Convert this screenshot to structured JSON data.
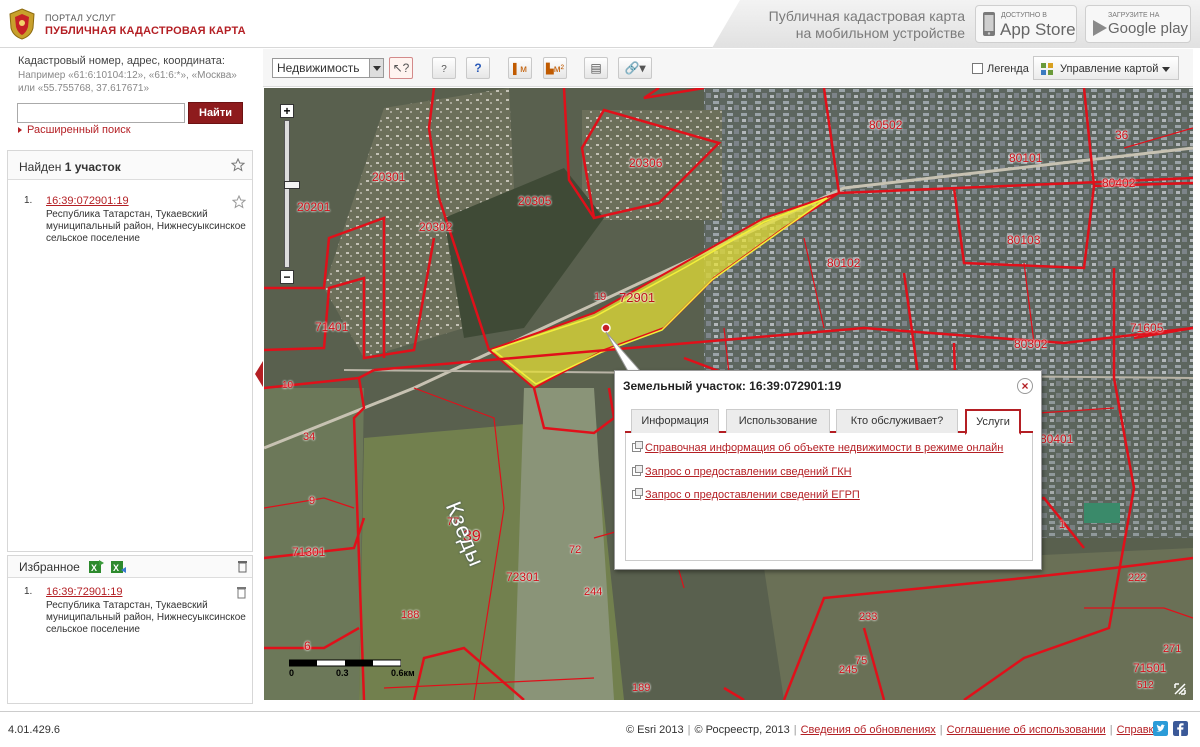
{
  "header": {
    "portal_small": "ПОРТАЛ УСЛУГ",
    "portal_title": "ПУБЛИЧНАЯ КАДАСТРОВАЯ КАРТА",
    "mobile_text": "Публичная кадастровая карта на мобильном устройстве",
    "appstore_small": "Доступно в",
    "appstore_big": "App Store",
    "googleplay_small": "Загрузите на",
    "googleplay_big": "Google play"
  },
  "search": {
    "label": "Кадастровый номер, адрес, координата:",
    "hint": "Например «61:6:10104:12», «61:6:*», «Москва» или «55.755768, 37.617671»",
    "value": "",
    "button": "Найти",
    "advanced": "Расширенный поиск"
  },
  "results": {
    "found_prefix": "Найден ",
    "found_count": "1 участок",
    "items": [
      {
        "num": "1.",
        "id": "16:39:072901:19",
        "address": "Республика Татарстан, Тукаевский муниципальный район, Нижнесуыксинское сельское поселение"
      }
    ]
  },
  "favorites": {
    "title": "Избранное",
    "items": [
      {
        "num": "1.",
        "id": "16:39:72901:19",
        "address": "Республика Татарстан, Тукаевский муниципальный район, Нижнесуыксинское сельское поселение"
      }
    ]
  },
  "toolbar": {
    "layer_select": "Недвижимость",
    "legend": "Легенда",
    "map_control": "Управление картой"
  },
  "map": {
    "labels": [
      "80502",
      "20306",
      "20301",
      "20201",
      "20305",
      "20302",
      "80101",
      "36",
      "80402",
      "80103",
      "80102",
      "71401",
      "71605",
      "80302",
      "10",
      "34",
      "80401",
      "9",
      "77",
      "39",
      "72",
      "71301",
      "72301",
      "244",
      "188",
      "222",
      "233",
      "75",
      "245",
      "6",
      "189",
      "271",
      "71501",
      "512",
      "1",
      "19",
      "72901"
    ],
    "river_label": "Кзеды",
    "scale_labels": [
      "0",
      "0.3",
      "0.6км"
    ]
  },
  "popup": {
    "title": "Земельный участок: 16:39:072901:19",
    "tabs": [
      "Информация",
      "Использование",
      "Кто обслуживает?",
      "Услуги"
    ],
    "active_tab": "Услуги",
    "services": [
      "Справочная информация об объекте недвижимости в режиме онлайн",
      "Запрос о предоставлении сведений ГКН",
      "Запрос о предоставлении сведений ЕГРП"
    ]
  },
  "footer": {
    "version": "4.01.429.6",
    "esri": "© Esri 2013",
    "rosreestr": "© Росреестр, 2013",
    "links": [
      "Сведения об обновлениях",
      "Соглашение об использовании",
      "Справка"
    ]
  },
  "colors": {
    "brand": "#b41f24",
    "parcel_line": "#e0101a",
    "selected_fill": "#e8e234"
  }
}
